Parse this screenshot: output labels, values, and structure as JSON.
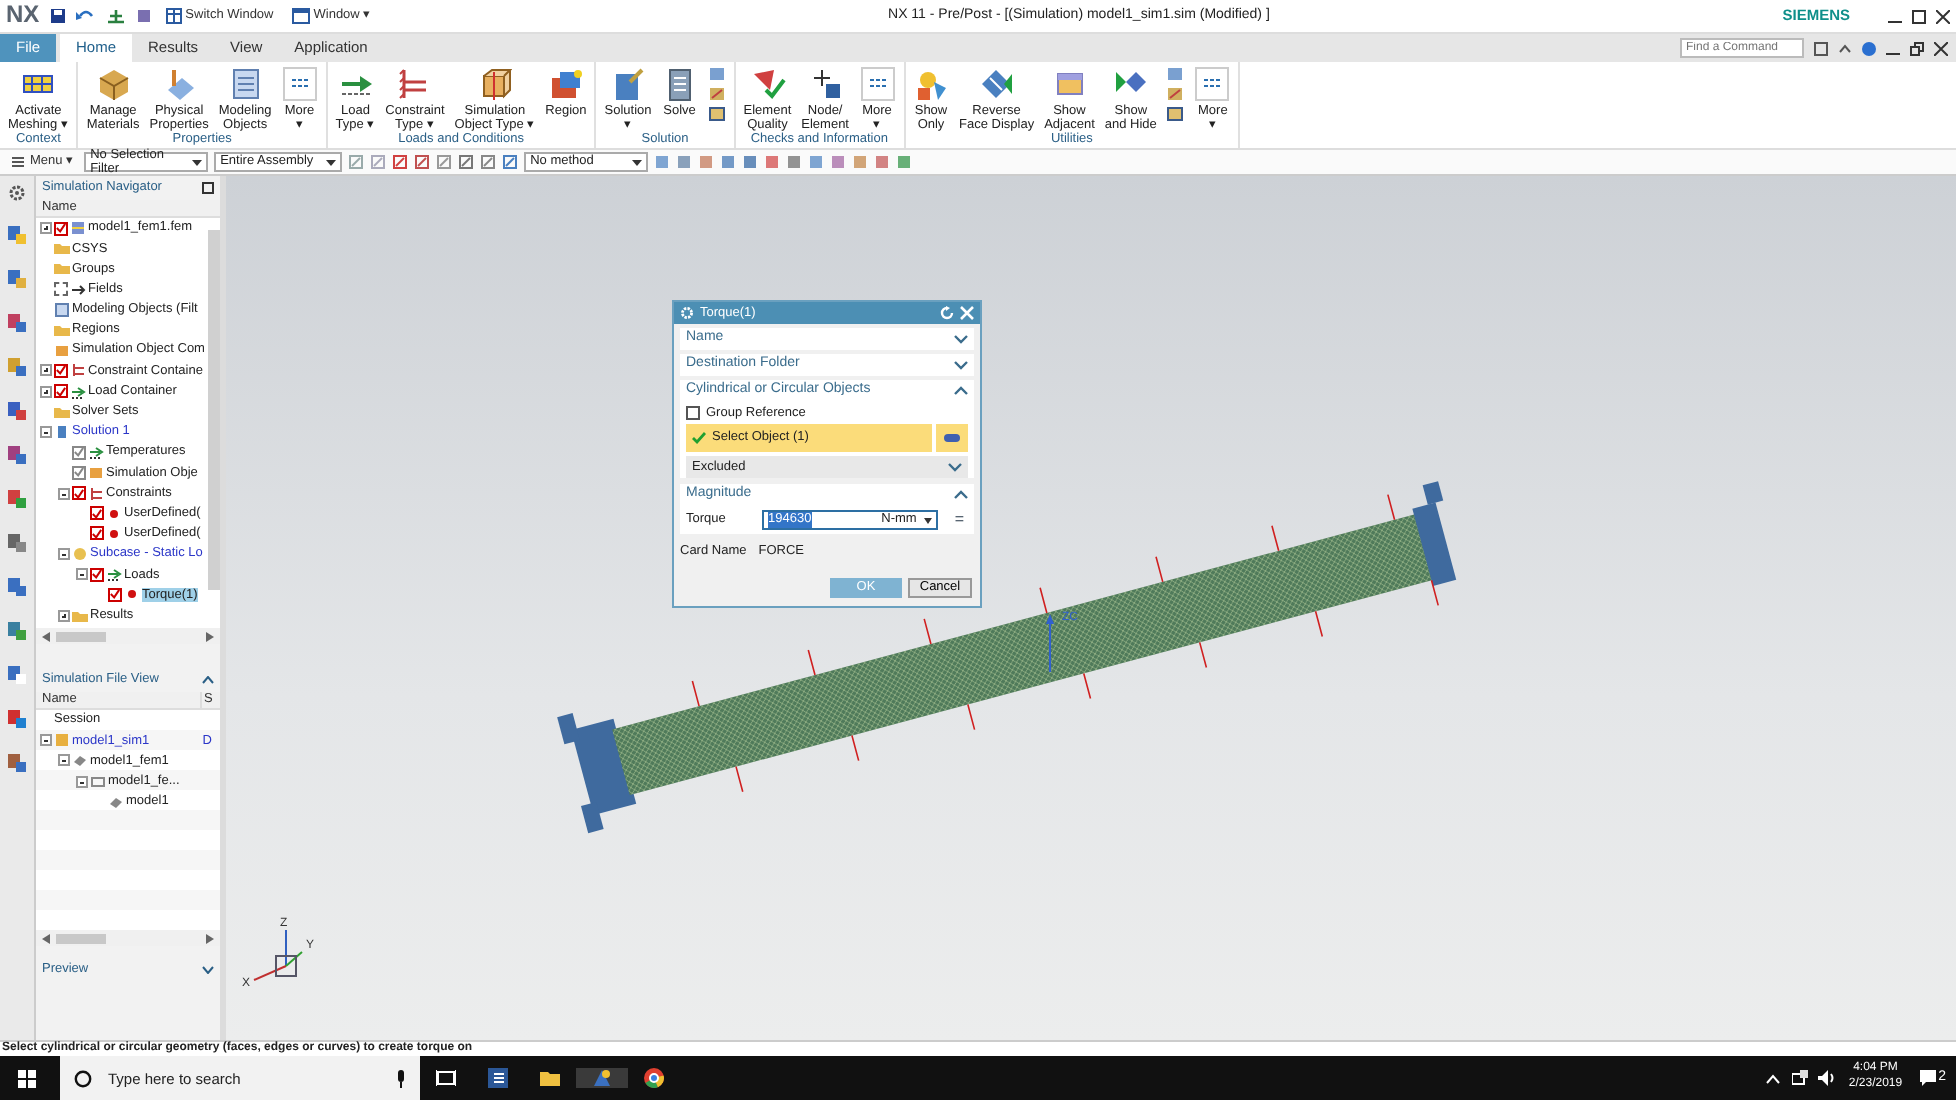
{
  "title_bar": {
    "logo": "NX",
    "switch_window": "Switch Window",
    "window_menu": "Window ▾",
    "title": "NX 11 - Pre/Post - [(Simulation) model1_sim1.sim (Modified) ]",
    "brand": "SIEMENS"
  },
  "tabs": [
    {
      "label": "File",
      "kind": "file",
      "selected": false
    },
    {
      "label": "Home",
      "kind": "tab",
      "selected": true
    },
    {
      "label": "Results",
      "kind": "tab",
      "selected": false
    },
    {
      "label": "View",
      "kind": "tab",
      "selected": false
    },
    {
      "label": "Application",
      "kind": "tab",
      "selected": false
    }
  ],
  "command_finder": {
    "placeholder": "Find a Command"
  },
  "ribbon_groups": [
    {
      "label": "Context",
      "buttons": [
        {
          "kind": "mesh",
          "lines": [
            "Activate",
            "Meshing ▾"
          ]
        }
      ]
    },
    {
      "label": "Properties",
      "buttons": [
        {
          "kind": "materials",
          "lines": [
            "Manage",
            "Materials"
          ]
        },
        {
          "kind": "physical",
          "lines": [
            "Physical",
            "Properties"
          ]
        },
        {
          "kind": "modeling",
          "lines": [
            "Modeling",
            "Objects"
          ]
        },
        {
          "kind": "more",
          "lines": [
            "More",
            "▾"
          ]
        }
      ]
    },
    {
      "label": "Loads and Conditions",
      "buttons": [
        {
          "kind": "load",
          "lines": [
            "Load",
            "Type ▾"
          ]
        },
        {
          "kind": "constraint",
          "lines": [
            "Constraint",
            "Type ▾"
          ]
        },
        {
          "kind": "simobj",
          "lines": [
            "Simulation",
            "Object Type ▾"
          ]
        },
        {
          "kind": "region",
          "lines": [
            "Region"
          ]
        }
      ]
    },
    {
      "label": "Solution",
      "buttons": [
        {
          "kind": "solution",
          "lines": [
            "Solution",
            "▾"
          ]
        },
        {
          "kind": "solve",
          "lines": [
            "Solve"
          ]
        },
        {
          "kind": "stack"
        }
      ]
    },
    {
      "label": "Checks and Information",
      "buttons": [
        {
          "kind": "quality",
          "lines": [
            "Element",
            "Quality"
          ]
        },
        {
          "kind": "node",
          "lines": [
            "Node/",
            "Element"
          ]
        },
        {
          "kind": "more",
          "lines": [
            "More",
            "▾"
          ]
        }
      ]
    },
    {
      "label": "Utilities",
      "buttons": [
        {
          "kind": "showonly",
          "lines": [
            "Show",
            "Only"
          ]
        },
        {
          "kind": "reverse",
          "lines": [
            "Reverse",
            "Face Display"
          ]
        },
        {
          "kind": "adjacent",
          "lines": [
            "Show",
            "Adjacent"
          ]
        },
        {
          "kind": "showhide",
          "lines": [
            "Show",
            "and Hide"
          ]
        },
        {
          "kind": "stack"
        },
        {
          "kind": "more",
          "lines": [
            "More",
            "▾"
          ]
        }
      ]
    }
  ],
  "toolbar": {
    "menu": "Menu ▾",
    "selection_filter": "No Selection Filter",
    "scope": "Entire Assembly",
    "snap_method": "No method"
  },
  "navigator": {
    "title": "Simulation Navigator",
    "column": "Name",
    "tree": [
      {
        "label": "model1_fem1.fem",
        "kind": "part",
        "expanded": false,
        "checked": true,
        "selected": false,
        "active": false
      },
      {
        "label": "CSYS",
        "kind": "folder",
        "selected": false,
        "active": false
      },
      {
        "label": "Groups",
        "kind": "folder",
        "selected": false,
        "active": false
      },
      {
        "label": "Fields",
        "kind": "field",
        "checked": false,
        "selected": false,
        "active": false
      },
      {
        "label": "Modeling Objects (Filt",
        "kind": "modeling",
        "selected": false,
        "active": false
      },
      {
        "label": "Regions",
        "kind": "folder",
        "selected": false,
        "active": false
      },
      {
        "label": "Simulation Object Com",
        "kind": "simobj",
        "selected": false,
        "active": false
      },
      {
        "label": "Constraint Containe",
        "kind": "constraint",
        "expanded": false,
        "checked": true,
        "selected": false,
        "active": false
      },
      {
        "label": "Load Container",
        "kind": "load",
        "expanded": false,
        "checked": true,
        "selected": false,
        "active": false
      },
      {
        "label": "Solver Sets",
        "kind": "folder",
        "selected": false,
        "active": false
      },
      {
        "label": "Solution 1",
        "kind": "solution",
        "expanded": true,
        "selected": false,
        "active": true,
        "children": [
          {
            "label": "Temperatures",
            "kind": "load",
            "checked": true,
            "disabled": true,
            "selected": false,
            "active": false
          },
          {
            "label": "Simulation Obje",
            "kind": "simobj",
            "checked": true,
            "disabled": true,
            "selected": false,
            "active": false
          },
          {
            "label": "Constraints",
            "kind": "constraint",
            "expanded": true,
            "checked": true,
            "selected": false,
            "active": false,
            "children": [
              {
                "label": "UserDefined(",
                "kind": "item",
                "checked": true,
                "selected": false,
                "active": false
              },
              {
                "label": "UserDefined(",
                "kind": "item",
                "checked": true,
                "selected": false,
                "active": false
              }
            ]
          },
          {
            "label": "Subcase - Static Lo",
            "kind": "subcase",
            "expanded": true,
            "selected": false,
            "active": true,
            "children": [
              {
                "label": "Loads",
                "kind": "load",
                "expanded": true,
                "checked": true,
                "selected": false,
                "active": false,
                "children": [
                  {
                    "label": "Torque(1)",
                    "kind": "item",
                    "checked": true,
                    "selected": true,
                    "active": false
                  }
                ]
              }
            ]
          },
          {
            "label": "Results",
            "kind": "folder",
            "expanded": false,
            "selected": false,
            "active": false
          }
        ]
      }
    ]
  },
  "file_view": {
    "title": "Simulation File View",
    "columns": [
      "Name",
      "S"
    ],
    "tree": [
      {
        "label": "Session"
      },
      {
        "label": "model1_sim1",
        "kind": "sim",
        "status": "D",
        "active": true,
        "expanded": true,
        "children": [
          {
            "label": "model1_fem1",
            "kind": "fem",
            "active": false,
            "expanded": true,
            "children": [
              {
                "label": "model1_fe...",
                "kind": "idealized",
                "active": false,
                "expanded": true,
                "children": [
                  {
                    "label": "model1",
                    "kind": "fem",
                    "active": false
                  }
                ]
              }
            ]
          }
        ]
      }
    ]
  },
  "preview": {
    "title": "Preview",
    "expanded": false
  },
  "viewport": {
    "axis_label": "ZC",
    "triad": [
      "Z",
      "X",
      "Y"
    ]
  },
  "dialog": {
    "title": "Torque(1)",
    "sections": [
      {
        "title": "Name",
        "expanded": false
      },
      {
        "title": "Destination Folder",
        "expanded": false
      },
      {
        "title": "Cylindrical or Circular Objects",
        "expanded": true,
        "rows": [
          {
            "kind": "checkbox",
            "label": "Group Reference",
            "checked": false
          },
          {
            "kind": "select",
            "label": "Select Object (1)",
            "selected": true
          },
          {
            "kind": "dropdown",
            "label": "Excluded"
          }
        ]
      },
      {
        "title": "Magnitude",
        "expanded": true,
        "rows": [
          {
            "kind": "value",
            "label": "Torque",
            "value": "194630",
            "text_selected": true,
            "unit": "N-mm",
            "formula_button": "="
          }
        ]
      }
    ],
    "card_name": {
      "label": "Card Name",
      "value": "FORCE"
    },
    "buttons": [
      {
        "label": "OK",
        "kind": "primary"
      },
      {
        "label": "Cancel",
        "kind": "secondary"
      }
    ]
  },
  "status_bar": {
    "message": "Select cylindrical or circular geometry (faces, edges or curves) to create torque on"
  },
  "taskbar": {
    "search_placeholder": "Type here to search",
    "time": "4:04 PM",
    "date": "2/23/2019",
    "notification_count": "2"
  }
}
